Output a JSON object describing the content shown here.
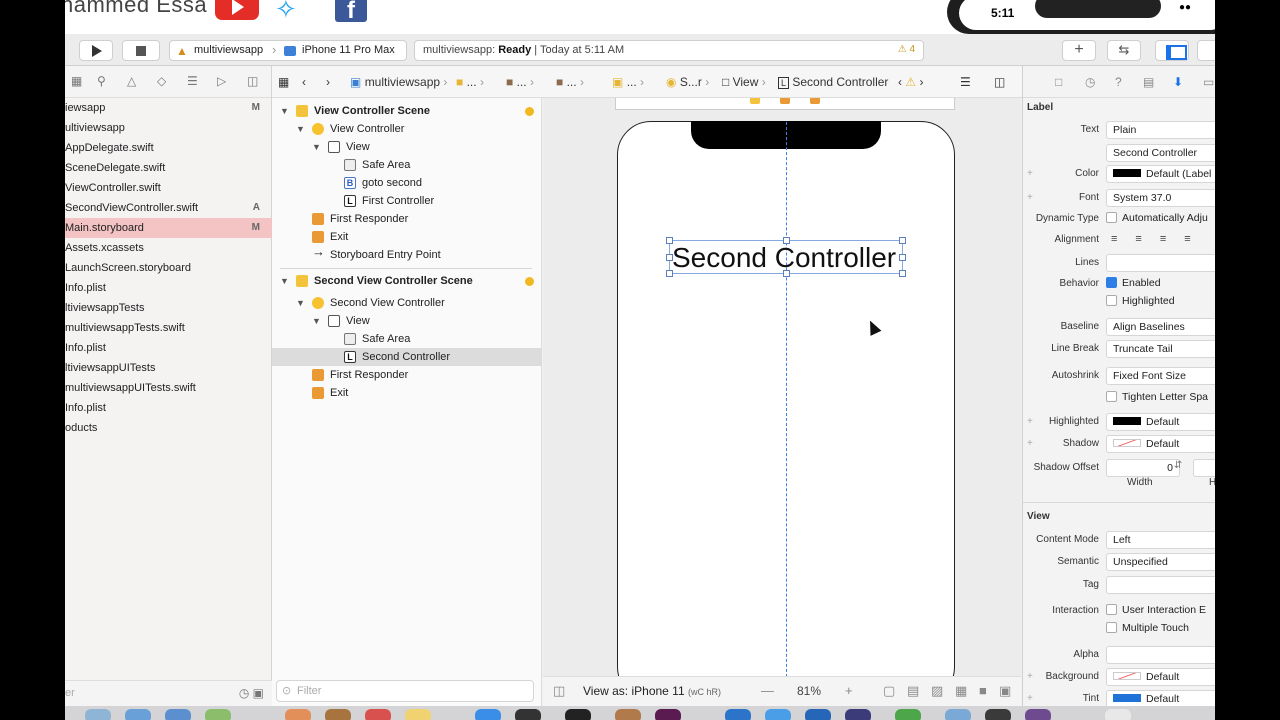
{
  "overlay": {
    "presenter_name": "hammed Essa",
    "phone_time": "5:11"
  },
  "toolbar": {
    "scheme_app": "multiviewsapp",
    "scheme_device": "iPhone 11 Pro Max",
    "status_prefix": "multiviewsapp: ",
    "status_state": "Ready",
    "status_time": " | Today at 5:11 AM",
    "warning_count": "4",
    "add_label": "+"
  },
  "navigator": {
    "files": [
      {
        "name": "iewsapp",
        "badge": "M"
      },
      {
        "name": "ultiviewsapp",
        "badge": ""
      },
      {
        "name": "AppDelegate.swift",
        "badge": ""
      },
      {
        "name": "SceneDelegate.swift",
        "badge": ""
      },
      {
        "name": "ViewController.swift",
        "badge": ""
      },
      {
        "name": "SecondViewController.swift",
        "badge": "A"
      },
      {
        "name": "Main.storyboard",
        "badge": "M"
      },
      {
        "name": "Assets.xcassets",
        "badge": ""
      },
      {
        "name": "LaunchScreen.storyboard",
        "badge": ""
      },
      {
        "name": "Info.plist",
        "badge": ""
      },
      {
        "name": "ltiviewsappTests",
        "badge": ""
      },
      {
        "name": "multiviewsappTests.swift",
        "badge": ""
      },
      {
        "name": "Info.plist",
        "badge": ""
      },
      {
        "name": "ltiviewsappUITests",
        "badge": ""
      },
      {
        "name": "multiviewsappUITests.swift",
        "badge": ""
      },
      {
        "name": "Info.plist",
        "badge": ""
      },
      {
        "name": "oducts",
        "badge": ""
      }
    ],
    "filter_placeholder": "er"
  },
  "jumpbar": {
    "project": "multiviewsapp",
    "ellipsis": "...",
    "scene_short": "S...r",
    "view": "View",
    "controller": "Second Controller"
  },
  "outline": {
    "rows": [
      {
        "text": "View Controller Scene",
        "icon": "scene"
      },
      {
        "text": "View Controller",
        "icon": "controller"
      },
      {
        "text": "View",
        "icon": "view"
      },
      {
        "text": "Safe Area",
        "icon": "safe-area"
      },
      {
        "text": "goto second",
        "icon": "button"
      },
      {
        "text": "First Controller",
        "icon": "label"
      },
      {
        "text": "First Responder",
        "icon": "responder"
      },
      {
        "text": "Exit",
        "icon": "exit"
      },
      {
        "text": "Storyboard Entry Point",
        "icon": "arrow"
      },
      {
        "text": "Second View Controller Scene",
        "icon": "scene"
      },
      {
        "text": "Second View Controller",
        "icon": "controller"
      },
      {
        "text": "View",
        "icon": "view"
      },
      {
        "text": "Safe Area",
        "icon": "safe-area"
      },
      {
        "text": "Second Controller",
        "icon": "label"
      },
      {
        "text": "First Responder",
        "icon": "responder"
      },
      {
        "text": "Exit",
        "icon": "exit"
      }
    ],
    "filter_placeholder": "Filter"
  },
  "canvas": {
    "label_text": "Second Controller",
    "view_as_prefix": "View as: ",
    "view_as_device": "iPhone 11",
    "size_class": "(wC hR)",
    "zoom": "81%"
  },
  "inspector": {
    "label_section": "Label",
    "text_label": "Text",
    "text_type": "Plain",
    "text_value": "Second Controller",
    "color_label": "Color",
    "color_value": "Default (Label",
    "font_label": "Font",
    "font_value": "System 37.0",
    "dynamic_type_label": "Dynamic Type",
    "dynamic_type_value": "Automatically Adju",
    "alignment_label": "Alignment",
    "lines_label": "Lines",
    "behavior_label": "Behavior",
    "enabled_label": "Enabled",
    "highlighted_check": "Highlighted",
    "baseline_label": "Baseline",
    "baseline_value": "Align Baselines",
    "line_break_label": "Line Break",
    "line_break_value": "Truncate Tail",
    "autoshrink_label": "Autoshrink",
    "autoshrink_value": "Fixed Font Size",
    "tighten_label": "Tighten Letter Spa",
    "highlighted_label": "Highlighted",
    "highlighted_value": "Default",
    "shadow_label": "Shadow",
    "shadow_value": "Default",
    "shadow_offset_label": "Shadow Offset",
    "shadow_offset_value": "0",
    "width_caption": "Width",
    "height_caption": "H",
    "view_section": "View",
    "content_mode_label": "Content Mode",
    "content_mode_value": "Left",
    "semantic_label": "Semantic",
    "semantic_value": "Unspecified",
    "tag_label": "Tag",
    "interaction_label": "Interaction",
    "user_interaction_label": "User Interaction E",
    "multiple_touch_label": "Multiple Touch",
    "alpha_label": "Alpha",
    "background_label": "Background",
    "background_value": "Default",
    "tint_label": "Tint",
    "tint_value": "Default",
    "colors": {
      "text_color": "#000000",
      "tint_color": "#1f72d8",
      "accent": "#2e7ee8"
    }
  }
}
